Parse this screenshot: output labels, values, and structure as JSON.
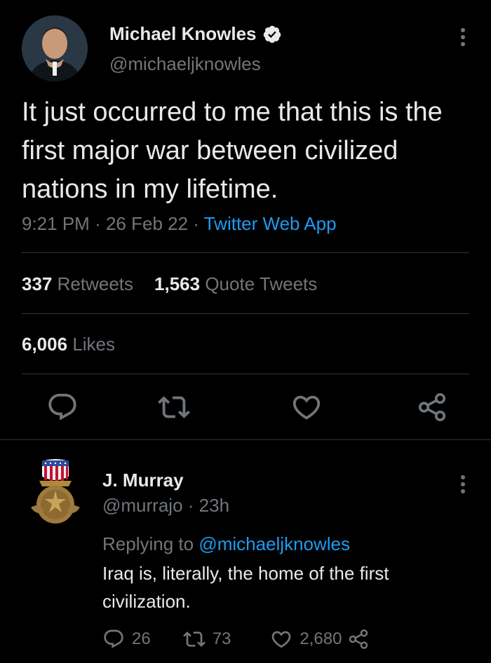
{
  "main_tweet": {
    "author_name": "Michael Knowles",
    "author_handle": "@michaeljknowles",
    "text": "It just occurred to me that this is the first major war between civilized nations in my lifetime.",
    "time": "9:21 PM",
    "date": "26 Feb 22",
    "separator": "·",
    "source": "Twitter Web App",
    "stats": {
      "retweets_count": "337",
      "retweets_label": "Retweets",
      "quotes_count": "1,563",
      "quotes_label": "Quote Tweets",
      "likes_count": "6,006",
      "likes_label": "Likes"
    },
    "icons": [
      "avatar",
      "verified-badge-icon",
      "more-options-icon",
      "reply-icon",
      "retweet-icon",
      "like-icon",
      "share-icon"
    ]
  },
  "reply": {
    "author_name": "J. Murray",
    "author_handle": "@murrajo",
    "separator": "·",
    "time_ago": "23h",
    "replying_prefix": "Replying to",
    "replying_to": "@michaeljknowles",
    "text": "Iraq is, literally, the home of the first civilization.",
    "reply_count": "26",
    "retweet_count": "73",
    "like_count": "2,680"
  },
  "colors": {
    "background": "#000000",
    "text_primary": "#e7e9ea",
    "text_secondary": "#71767b",
    "accent": "#1d9bf0",
    "divider": "#2f3336"
  }
}
